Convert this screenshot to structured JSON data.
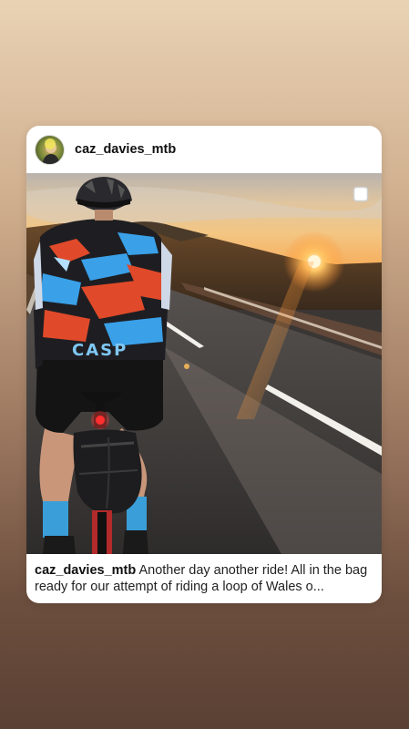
{
  "post": {
    "username": "caz_davies_mtb",
    "caption_username": "caz_davies_mtb",
    "caption_text": " Another day another ride! All in the bag ready for our attempt of riding a loop of Wales o...",
    "jersey_text": "CASP"
  },
  "icons": {
    "avatar": "profile-avatar",
    "multi": "carousel-indicator-icon"
  },
  "colors": {
    "sun": "#ffb347",
    "sky": "#f4c98a",
    "road": "#3b3838",
    "jersey_blue": "#3aa0e8",
    "jersey_red": "#e04a2a"
  }
}
